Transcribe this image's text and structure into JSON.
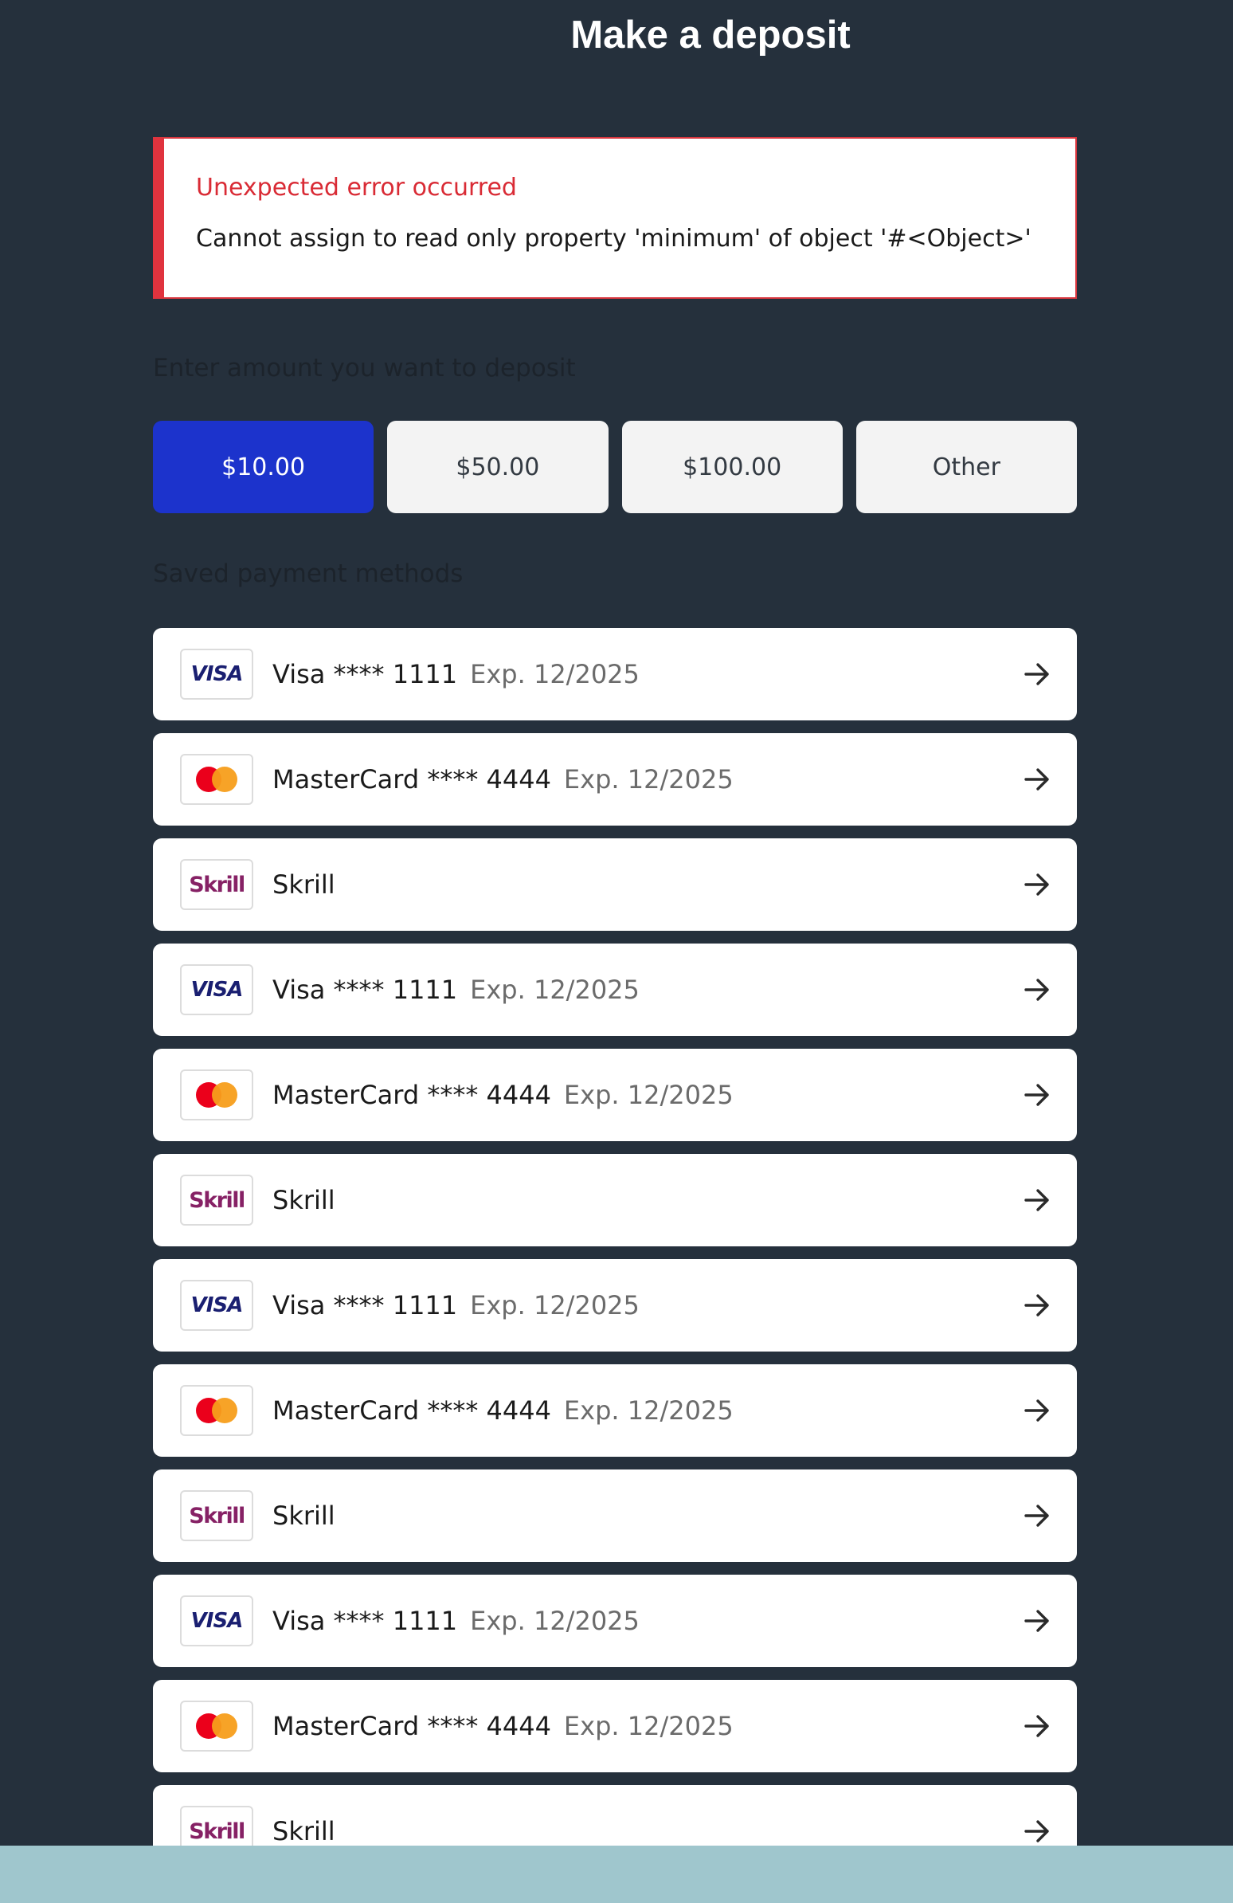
{
  "header": {
    "title": "Make a deposit"
  },
  "error": {
    "title": "Unexpected error occurred",
    "message": "Cannot assign to read only property 'minimum' of object '#<Object>'"
  },
  "amount_section": {
    "label": "Enter amount you want to deposit",
    "options": [
      {
        "label": "$10.00",
        "selected": true
      },
      {
        "label": "$50.00",
        "selected": false
      },
      {
        "label": "$100.00",
        "selected": false
      },
      {
        "label": "Other",
        "selected": false
      }
    ]
  },
  "payment_section": {
    "label": "Saved payment methods",
    "methods": [
      {
        "brand": "visa",
        "logo_text": "VISA",
        "name": "Visa **** 1111",
        "expiry": "Exp. 12/2025"
      },
      {
        "brand": "mastercard",
        "name": "MasterCard **** 4444",
        "expiry": "Exp. 12/2025"
      },
      {
        "brand": "skrill",
        "logo_text": "Skrill",
        "name": "Skrill",
        "expiry": ""
      },
      {
        "brand": "visa",
        "logo_text": "VISA",
        "name": "Visa **** 1111",
        "expiry": "Exp. 12/2025"
      },
      {
        "brand": "mastercard",
        "name": "MasterCard **** 4444",
        "expiry": "Exp. 12/2025"
      },
      {
        "brand": "skrill",
        "logo_text": "Skrill",
        "name": "Skrill",
        "expiry": ""
      },
      {
        "brand": "visa",
        "logo_text": "VISA",
        "name": "Visa **** 1111",
        "expiry": "Exp. 12/2025"
      },
      {
        "brand": "mastercard",
        "name": "MasterCard **** 4444",
        "expiry": "Exp. 12/2025"
      },
      {
        "brand": "skrill",
        "logo_text": "Skrill",
        "name": "Skrill",
        "expiry": ""
      },
      {
        "brand": "visa",
        "logo_text": "VISA",
        "name": "Visa **** 1111",
        "expiry": "Exp. 12/2025"
      },
      {
        "brand": "mastercard",
        "name": "MasterCard **** 4444",
        "expiry": "Exp. 12/2025"
      },
      {
        "brand": "skrill",
        "logo_text": "Skrill",
        "name": "Skrill",
        "expiry": ""
      }
    ]
  },
  "colors": {
    "background": "#25303c",
    "accent": "#1c33cc",
    "error": "#d92b35",
    "visa": "#1a1f71",
    "skrill": "#862165",
    "mastercard_red": "#eb001b",
    "mastercard_orange": "#f79e1b",
    "bottom_bar": "#9fc6cd"
  },
  "icons": {
    "arrow": "arrow-right-icon"
  }
}
